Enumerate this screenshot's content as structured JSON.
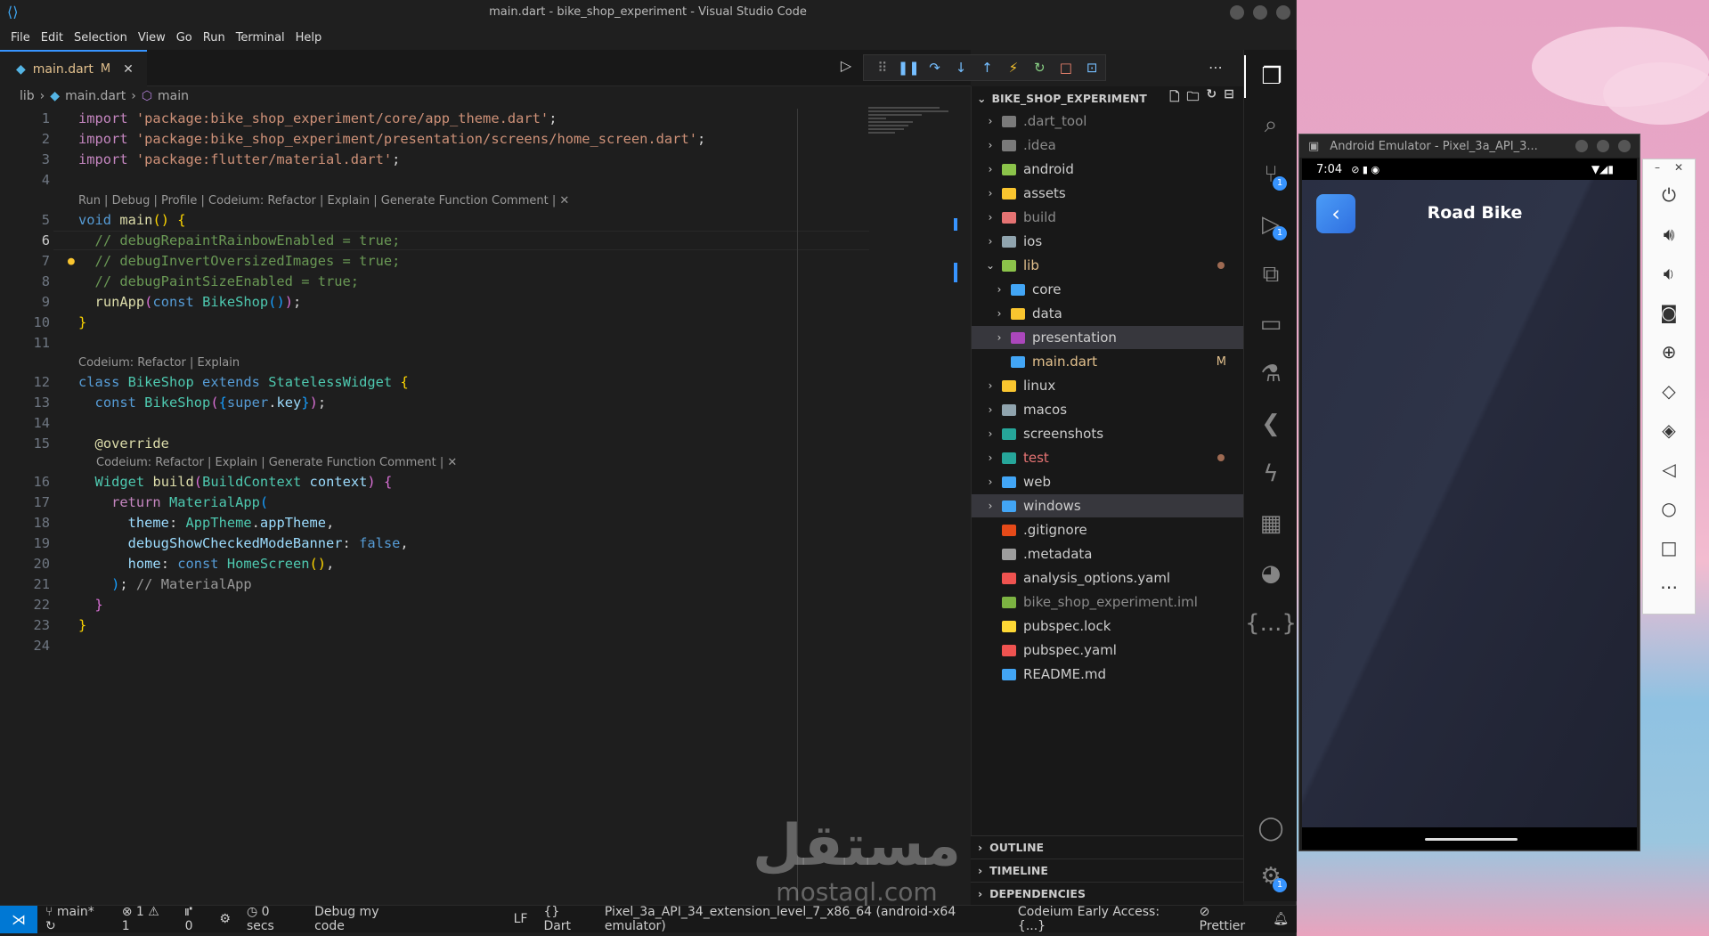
{
  "window": {
    "title": "main.dart - bike_shop_experiment - Visual Studio Code"
  },
  "menu": [
    "File",
    "Edit",
    "Selection",
    "View",
    "Go",
    "Run",
    "Terminal",
    "Help"
  ],
  "tab": {
    "name": "main.dart",
    "status": "M"
  },
  "breadcrumb": {
    "folder": "lib",
    "file": "main.dart",
    "symbol": "main"
  },
  "code": {
    "line_numbers": [
      "1",
      "2",
      "3",
      "4",
      "5",
      "6",
      "7",
      "8",
      "9",
      "10",
      "11",
      "12",
      "13",
      "14",
      "15",
      "16",
      "17",
      "18",
      "19",
      "20",
      "21",
      "22",
      "23",
      "24"
    ],
    "l1_kw": "import",
    "l1_str": "'package:bike_shop_experiment/core/app_theme.dart'",
    "l2_kw": "import",
    "l2_str": "'package:bike_shop_experiment/presentation/screens/home_screen.dart'",
    "l3_kw": "import",
    "l3_str": "'package:flutter/material.dart'",
    "lens_main": "Run | Debug | Profile | Codeium: Refactor | Explain | Generate Function Comment | ✕",
    "l5_kw": "void",
    "l5_fn": "main",
    "l6": "// debugRepaintRainbowEnabled = true;",
    "l7": "// debugInvertOversizedImages = true;",
    "l8": "// debugPaintSizeEnabled = true;",
    "l9_fn": "runApp",
    "l9_kw": "const",
    "l9_ty": "BikeShop",
    "lens_class": "Codeium: Refactor | Explain",
    "l12_kw": "class",
    "l12_ty": "BikeShop",
    "l12_kw2": "extends",
    "l12_ty2": "StatelessWidget",
    "l13_kw": "const",
    "l13_ty": "BikeShop",
    "l13_kw2": "super",
    "l13_pr": "key",
    "l15": "@override",
    "lens_build": "Codeium: Refactor | Explain | Generate Function Comment | ✕",
    "l16_ty": "Widget",
    "l16_fn": "build",
    "l16_ty2": "BuildContext",
    "l16_pr": "context",
    "l17_kw": "return",
    "l17_ty": "MaterialApp",
    "l18_pr": "theme",
    "l18_ty": "AppTheme",
    "l18_pr2": "appTheme",
    "l19_pr": "debugShowCheckedModeBanner",
    "l19_kw": "false",
    "l20_pr": "home",
    "l20_kw": "const",
    "l20_ty": "HomeScreen",
    "l21_cm": "// MaterialApp"
  },
  "explorer": {
    "title": "BIKE_SHOP_EXPERIMENT",
    "items": [
      {
        "label": ".dart_tool",
        "color": "#8a8a8a",
        "icon": "#7a7a7a"
      },
      {
        "label": ".idea",
        "color": "#8a8a8a",
        "icon": "#7a7a7a"
      },
      {
        "label": "android",
        "color": "#cccccc",
        "icon": "#8bc34a"
      },
      {
        "label": "assets",
        "color": "#cccccc",
        "icon": "#f9c52f"
      },
      {
        "label": "build",
        "color": "#8a8a8a",
        "icon": "#e57373"
      },
      {
        "label": "ios",
        "color": "#cccccc",
        "icon": "#90a4ae"
      },
      {
        "label": "lib",
        "color": "#e2c08d",
        "icon": "#8bc34a"
      },
      {
        "label": "core",
        "color": "#cccccc",
        "icon": "#42a5f5"
      },
      {
        "label": "data",
        "color": "#cccccc",
        "icon": "#f9c52f"
      },
      {
        "label": "presentation",
        "color": "#cccccc",
        "icon": "#ab47bc"
      },
      {
        "label": "main.dart",
        "color": "#e2c08d",
        "icon": "#42a5f5",
        "badge": "M"
      },
      {
        "label": "linux",
        "color": "#cccccc",
        "icon": "#f9c52f"
      },
      {
        "label": "macos",
        "color": "#cccccc",
        "icon": "#90a4ae"
      },
      {
        "label": "screenshots",
        "color": "#cccccc",
        "icon": "#26a69a"
      },
      {
        "label": "test",
        "color": "#e57373",
        "icon": "#26a69a"
      },
      {
        "label": "web",
        "color": "#cccccc",
        "icon": "#42a5f5"
      },
      {
        "label": "windows",
        "color": "#cccccc",
        "icon": "#42a5f5"
      },
      {
        "label": ".gitignore",
        "color": "#cccccc",
        "icon": "#e64a19"
      },
      {
        "label": ".metadata",
        "color": "#cccccc",
        "icon": "#9e9e9e"
      },
      {
        "label": "analysis_options.yaml",
        "color": "#cccccc",
        "icon": "#ef5350"
      },
      {
        "label": "bike_shop_experiment.iml",
        "color": "#8a8a8a",
        "icon": "#7cb342"
      },
      {
        "label": "pubspec.lock",
        "color": "#cccccc",
        "icon": "#fdd835"
      },
      {
        "label": "pubspec.yaml",
        "color": "#cccccc",
        "icon": "#ef5350"
      },
      {
        "label": "README.md",
        "color": "#cccccc",
        "icon": "#42a5f5"
      }
    ],
    "outline": "OUTLINE",
    "timeline": "TIMELINE",
    "dependencies": "DEPENDENCIES"
  },
  "activity": {
    "badges": [
      "1",
      "1",
      "1"
    ]
  },
  "status": {
    "branch": "main*",
    "problems": "⊗ 1 ⚠ 1",
    "ports": "⑈ 0",
    "timer": "0 secs",
    "debug": "Debug my code",
    "eol": "LF",
    "lang": "Dart",
    "device": "Pixel_3a_API_34_extension_level_7_x86_64 (android-x64 emulator)",
    "codeium": "Codeium Early Access: {...}",
    "prettier": "Prettier"
  },
  "watermark": {
    "arabic": "مستقل",
    "latin": "mostaql.com"
  },
  "emulator": {
    "title": "Android Emulator - Pixel_3a_API_3...",
    "time": "7:04",
    "app_title": "Road Bike"
  }
}
